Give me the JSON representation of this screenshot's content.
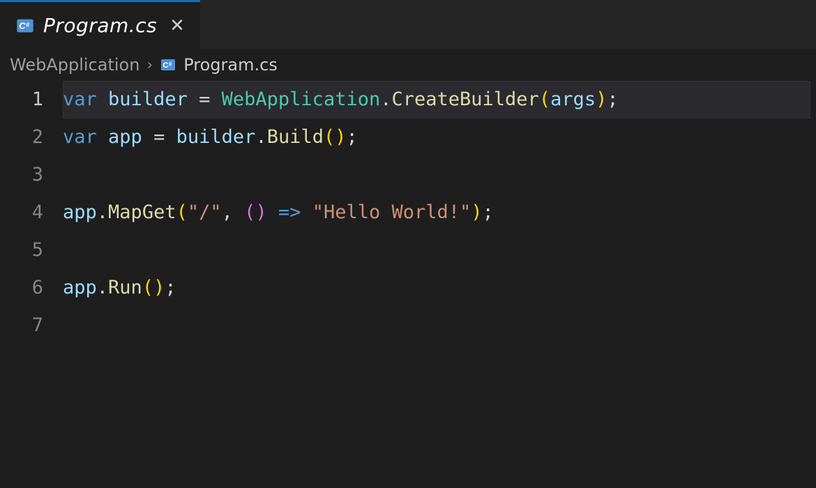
{
  "tab": {
    "filename": "Program.cs",
    "icon": "csharp-file-icon",
    "modified": false,
    "active": true
  },
  "breadcrumbs": {
    "items": [
      {
        "label": "WebApplication"
      },
      {
        "label": "Program.cs",
        "icon": "csharp-file-icon"
      }
    ]
  },
  "editor": {
    "language": "csharp",
    "current_line": 1,
    "line_numbers": [
      "1",
      "2",
      "3",
      "4",
      "5",
      "6",
      "7"
    ],
    "code": {
      "raw": "var builder = WebApplication.CreateBuilder(args);\nvar app = builder.Build();\n\napp.MapGet(\"/\", () => \"Hello World!\");\n\napp.Run();\n",
      "lines": [
        {
          "tokens": [
            {
              "t": "var",
              "c": "kw"
            },
            {
              "t": " ",
              "c": "default"
            },
            {
              "t": "builder",
              "c": "var"
            },
            {
              "t": " ",
              "c": "default"
            },
            {
              "t": "=",
              "c": "punct"
            },
            {
              "t": " ",
              "c": "default"
            },
            {
              "t": "WebApplication",
              "c": "type"
            },
            {
              "t": ".",
              "c": "punct"
            },
            {
              "t": "CreateBuilder",
              "c": "func"
            },
            {
              "t": "(",
              "c": "paren-y"
            },
            {
              "t": "args",
              "c": "var"
            },
            {
              "t": ")",
              "c": "paren-y"
            },
            {
              "t": ";",
              "c": "punct"
            }
          ]
        },
        {
          "tokens": [
            {
              "t": "var",
              "c": "kw"
            },
            {
              "t": " ",
              "c": "default"
            },
            {
              "t": "app",
              "c": "var"
            },
            {
              "t": " ",
              "c": "default"
            },
            {
              "t": "=",
              "c": "punct"
            },
            {
              "t": " ",
              "c": "default"
            },
            {
              "t": "builder",
              "c": "var"
            },
            {
              "t": ".",
              "c": "punct"
            },
            {
              "t": "Build",
              "c": "func"
            },
            {
              "t": "(",
              "c": "paren-y"
            },
            {
              "t": ")",
              "c": "paren-y"
            },
            {
              "t": ";",
              "c": "punct"
            }
          ]
        },
        {
          "tokens": [
            {
              "t": "",
              "c": "default"
            }
          ]
        },
        {
          "tokens": [
            {
              "t": "app",
              "c": "var"
            },
            {
              "t": ".",
              "c": "punct"
            },
            {
              "t": "MapGet",
              "c": "func"
            },
            {
              "t": "(",
              "c": "paren-y"
            },
            {
              "t": "\"/\"",
              "c": "str"
            },
            {
              "t": ",",
              "c": "punct"
            },
            {
              "t": " ",
              "c": "default"
            },
            {
              "t": "(",
              "c": "paren-p"
            },
            {
              "t": ")",
              "c": "paren-p"
            },
            {
              "t": " ",
              "c": "default"
            },
            {
              "t": "=>",
              "c": "kw"
            },
            {
              "t": " ",
              "c": "default"
            },
            {
              "t": "\"Hello World!\"",
              "c": "str"
            },
            {
              "t": ")",
              "c": "paren-y"
            },
            {
              "t": ";",
              "c": "punct"
            }
          ]
        },
        {
          "tokens": [
            {
              "t": "",
              "c": "default"
            }
          ]
        },
        {
          "tokens": [
            {
              "t": "app",
              "c": "var"
            },
            {
              "t": ".",
              "c": "punct"
            },
            {
              "t": "Run",
              "c": "func"
            },
            {
              "t": "(",
              "c": "paren-y"
            },
            {
              "t": ")",
              "c": "paren-y"
            },
            {
              "t": ";",
              "c": "punct"
            }
          ]
        },
        {
          "tokens": [
            {
              "t": "",
              "c": "default"
            }
          ]
        }
      ]
    }
  },
  "colors": {
    "background": "#1e1e1e",
    "tabbar": "#252526",
    "accent": "#0e70c0",
    "keyword": "#569cd6",
    "variable": "#9cdcfe",
    "type": "#4ec9b0",
    "function": "#dcdcaa",
    "string": "#ce9178",
    "punct": "#d4d4d4"
  }
}
